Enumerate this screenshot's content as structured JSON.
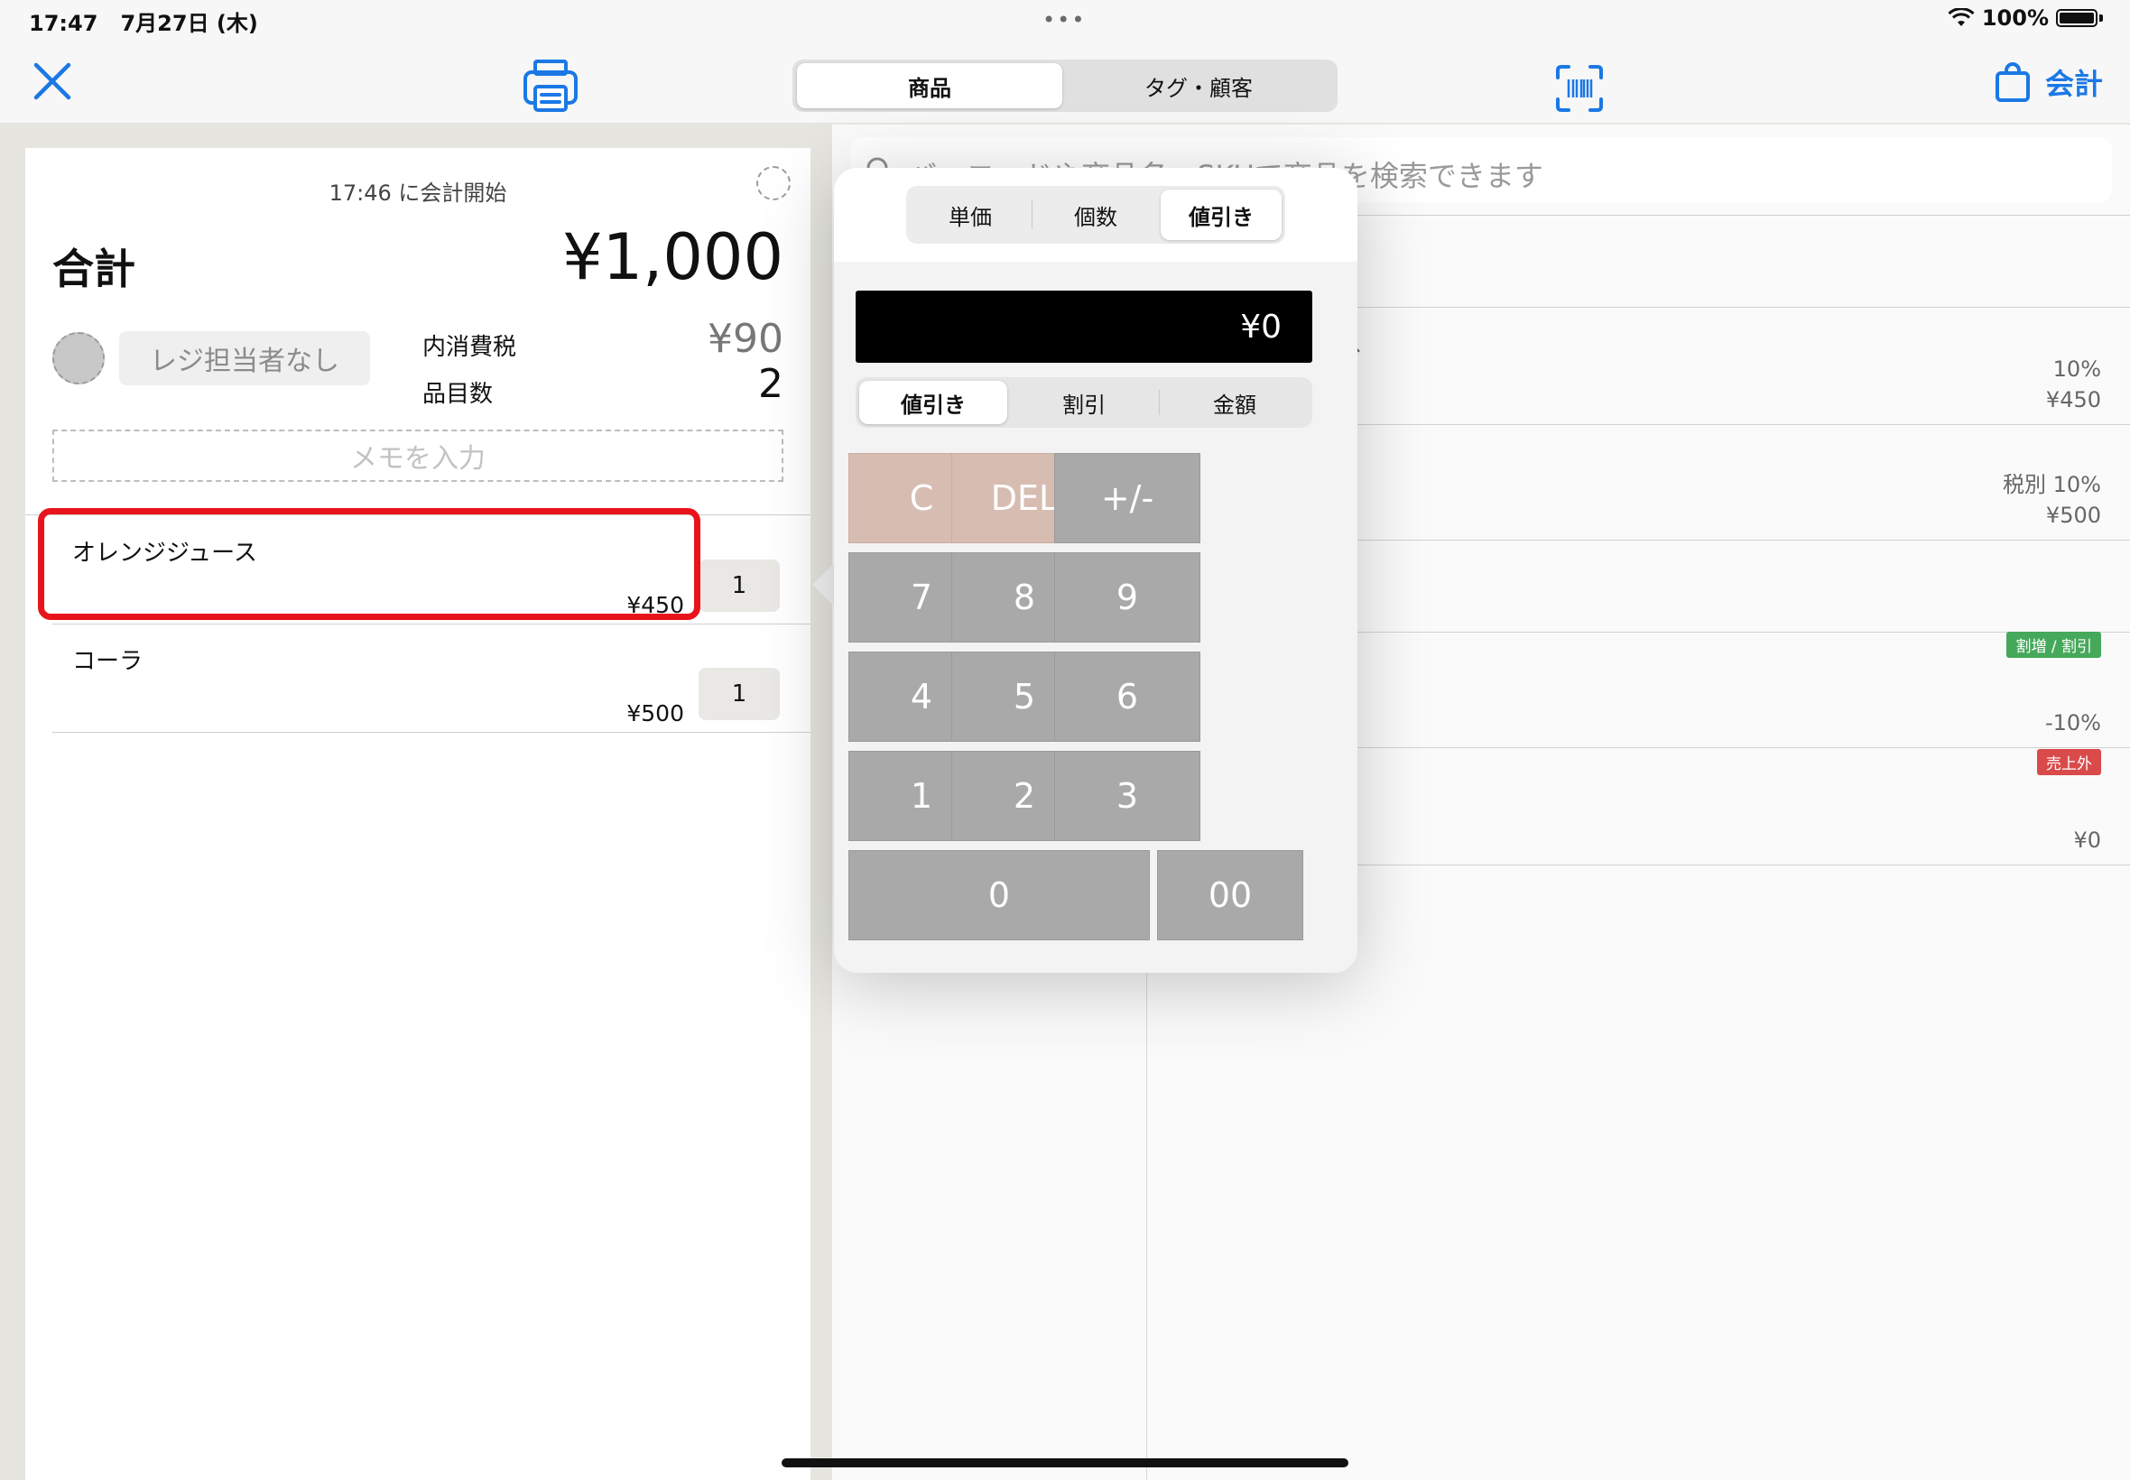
{
  "status": {
    "time": "17:47",
    "date": "7月27日 (木)",
    "battery": "100%"
  },
  "nav": {
    "segments": [
      "商品",
      "タグ・顧客"
    ],
    "checkout_label": "会計"
  },
  "cart": {
    "start_time": "17:46 に会計開始",
    "total_label": "合計",
    "total_value": "¥1,000",
    "staff_label": "レジ担当者なし",
    "tax_label": "内消費税",
    "tax_value": "¥90",
    "count_label": "品目数",
    "count_value": "2",
    "memo_placeholder": "メモを入力",
    "items": [
      {
        "name": "オレンジジュース",
        "price": "¥450",
        "qty": "1"
      },
      {
        "name": "コーラ",
        "price": "¥500",
        "qty": "1"
      }
    ]
  },
  "products": {
    "search_placeholder": "バーコードや商品名、SKUで商品を検索できます",
    "stray": "、",
    "rows": [
      {
        "meta1": "10%",
        "meta2": "¥450"
      },
      {
        "meta1": "税別 10%",
        "meta2": "¥500"
      },
      {
        "badge": "割増 / 割引",
        "meta2": "-10%"
      },
      {
        "badge": "売上外",
        "meta2": "¥0"
      }
    ]
  },
  "popover": {
    "tabs": [
      "単価",
      "個数",
      "値引き"
    ],
    "display": "¥0",
    "modes": [
      "値引き",
      "割引",
      "金額"
    ],
    "keys": [
      "C",
      "DEL",
      "+/-",
      "7",
      "8",
      "9",
      "4",
      "5",
      "6",
      "1",
      "2",
      "3",
      "0",
      "00"
    ]
  }
}
